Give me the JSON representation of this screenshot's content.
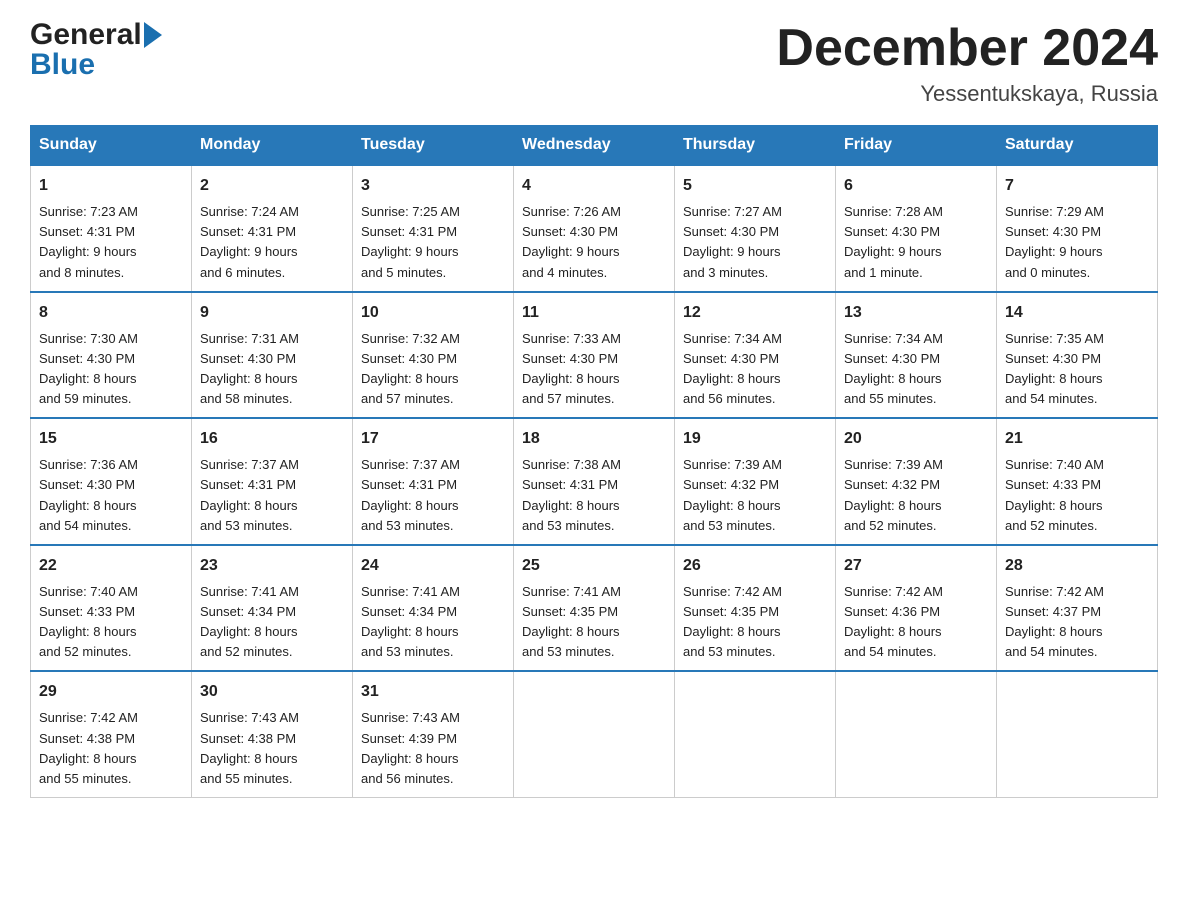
{
  "header": {
    "logo_general": "General",
    "logo_blue": "Blue",
    "title": "December 2024",
    "subtitle": "Yessentukskaya, Russia"
  },
  "days_header": [
    "Sunday",
    "Monday",
    "Tuesday",
    "Wednesday",
    "Thursday",
    "Friday",
    "Saturday"
  ],
  "weeks": [
    [
      {
        "num": "1",
        "sunrise": "7:23 AM",
        "sunset": "4:31 PM",
        "daylight": "9 hours and 8 minutes."
      },
      {
        "num": "2",
        "sunrise": "7:24 AM",
        "sunset": "4:31 PM",
        "daylight": "9 hours and 6 minutes."
      },
      {
        "num": "3",
        "sunrise": "7:25 AM",
        "sunset": "4:31 PM",
        "daylight": "9 hours and 5 minutes."
      },
      {
        "num": "4",
        "sunrise": "7:26 AM",
        "sunset": "4:30 PM",
        "daylight": "9 hours and 4 minutes."
      },
      {
        "num": "5",
        "sunrise": "7:27 AM",
        "sunset": "4:30 PM",
        "daylight": "9 hours and 3 minutes."
      },
      {
        "num": "6",
        "sunrise": "7:28 AM",
        "sunset": "4:30 PM",
        "daylight": "9 hours and 1 minute."
      },
      {
        "num": "7",
        "sunrise": "7:29 AM",
        "sunset": "4:30 PM",
        "daylight": "9 hours and 0 minutes."
      }
    ],
    [
      {
        "num": "8",
        "sunrise": "7:30 AM",
        "sunset": "4:30 PM",
        "daylight": "8 hours and 59 minutes."
      },
      {
        "num": "9",
        "sunrise": "7:31 AM",
        "sunset": "4:30 PM",
        "daylight": "8 hours and 58 minutes."
      },
      {
        "num": "10",
        "sunrise": "7:32 AM",
        "sunset": "4:30 PM",
        "daylight": "8 hours and 57 minutes."
      },
      {
        "num": "11",
        "sunrise": "7:33 AM",
        "sunset": "4:30 PM",
        "daylight": "8 hours and 57 minutes."
      },
      {
        "num": "12",
        "sunrise": "7:34 AM",
        "sunset": "4:30 PM",
        "daylight": "8 hours and 56 minutes."
      },
      {
        "num": "13",
        "sunrise": "7:34 AM",
        "sunset": "4:30 PM",
        "daylight": "8 hours and 55 minutes."
      },
      {
        "num": "14",
        "sunrise": "7:35 AM",
        "sunset": "4:30 PM",
        "daylight": "8 hours and 54 minutes."
      }
    ],
    [
      {
        "num": "15",
        "sunrise": "7:36 AM",
        "sunset": "4:30 PM",
        "daylight": "8 hours and 54 minutes."
      },
      {
        "num": "16",
        "sunrise": "7:37 AM",
        "sunset": "4:31 PM",
        "daylight": "8 hours and 53 minutes."
      },
      {
        "num": "17",
        "sunrise": "7:37 AM",
        "sunset": "4:31 PM",
        "daylight": "8 hours and 53 minutes."
      },
      {
        "num": "18",
        "sunrise": "7:38 AM",
        "sunset": "4:31 PM",
        "daylight": "8 hours and 53 minutes."
      },
      {
        "num": "19",
        "sunrise": "7:39 AM",
        "sunset": "4:32 PM",
        "daylight": "8 hours and 53 minutes."
      },
      {
        "num": "20",
        "sunrise": "7:39 AM",
        "sunset": "4:32 PM",
        "daylight": "8 hours and 52 minutes."
      },
      {
        "num": "21",
        "sunrise": "7:40 AM",
        "sunset": "4:33 PM",
        "daylight": "8 hours and 52 minutes."
      }
    ],
    [
      {
        "num": "22",
        "sunrise": "7:40 AM",
        "sunset": "4:33 PM",
        "daylight": "8 hours and 52 minutes."
      },
      {
        "num": "23",
        "sunrise": "7:41 AM",
        "sunset": "4:34 PM",
        "daylight": "8 hours and 52 minutes."
      },
      {
        "num": "24",
        "sunrise": "7:41 AM",
        "sunset": "4:34 PM",
        "daylight": "8 hours and 53 minutes."
      },
      {
        "num": "25",
        "sunrise": "7:41 AM",
        "sunset": "4:35 PM",
        "daylight": "8 hours and 53 minutes."
      },
      {
        "num": "26",
        "sunrise": "7:42 AM",
        "sunset": "4:35 PM",
        "daylight": "8 hours and 53 minutes."
      },
      {
        "num": "27",
        "sunrise": "7:42 AM",
        "sunset": "4:36 PM",
        "daylight": "8 hours and 54 minutes."
      },
      {
        "num": "28",
        "sunrise": "7:42 AM",
        "sunset": "4:37 PM",
        "daylight": "8 hours and 54 minutes."
      }
    ],
    [
      {
        "num": "29",
        "sunrise": "7:42 AM",
        "sunset": "4:38 PM",
        "daylight": "8 hours and 55 minutes."
      },
      {
        "num": "30",
        "sunrise": "7:43 AM",
        "sunset": "4:38 PM",
        "daylight": "8 hours and 55 minutes."
      },
      {
        "num": "31",
        "sunrise": "7:43 AM",
        "sunset": "4:39 PM",
        "daylight": "8 hours and 56 minutes."
      },
      null,
      null,
      null,
      null
    ]
  ],
  "labels": {
    "sunrise": "Sunrise:",
    "sunset": "Sunset:",
    "daylight": "Daylight:"
  }
}
